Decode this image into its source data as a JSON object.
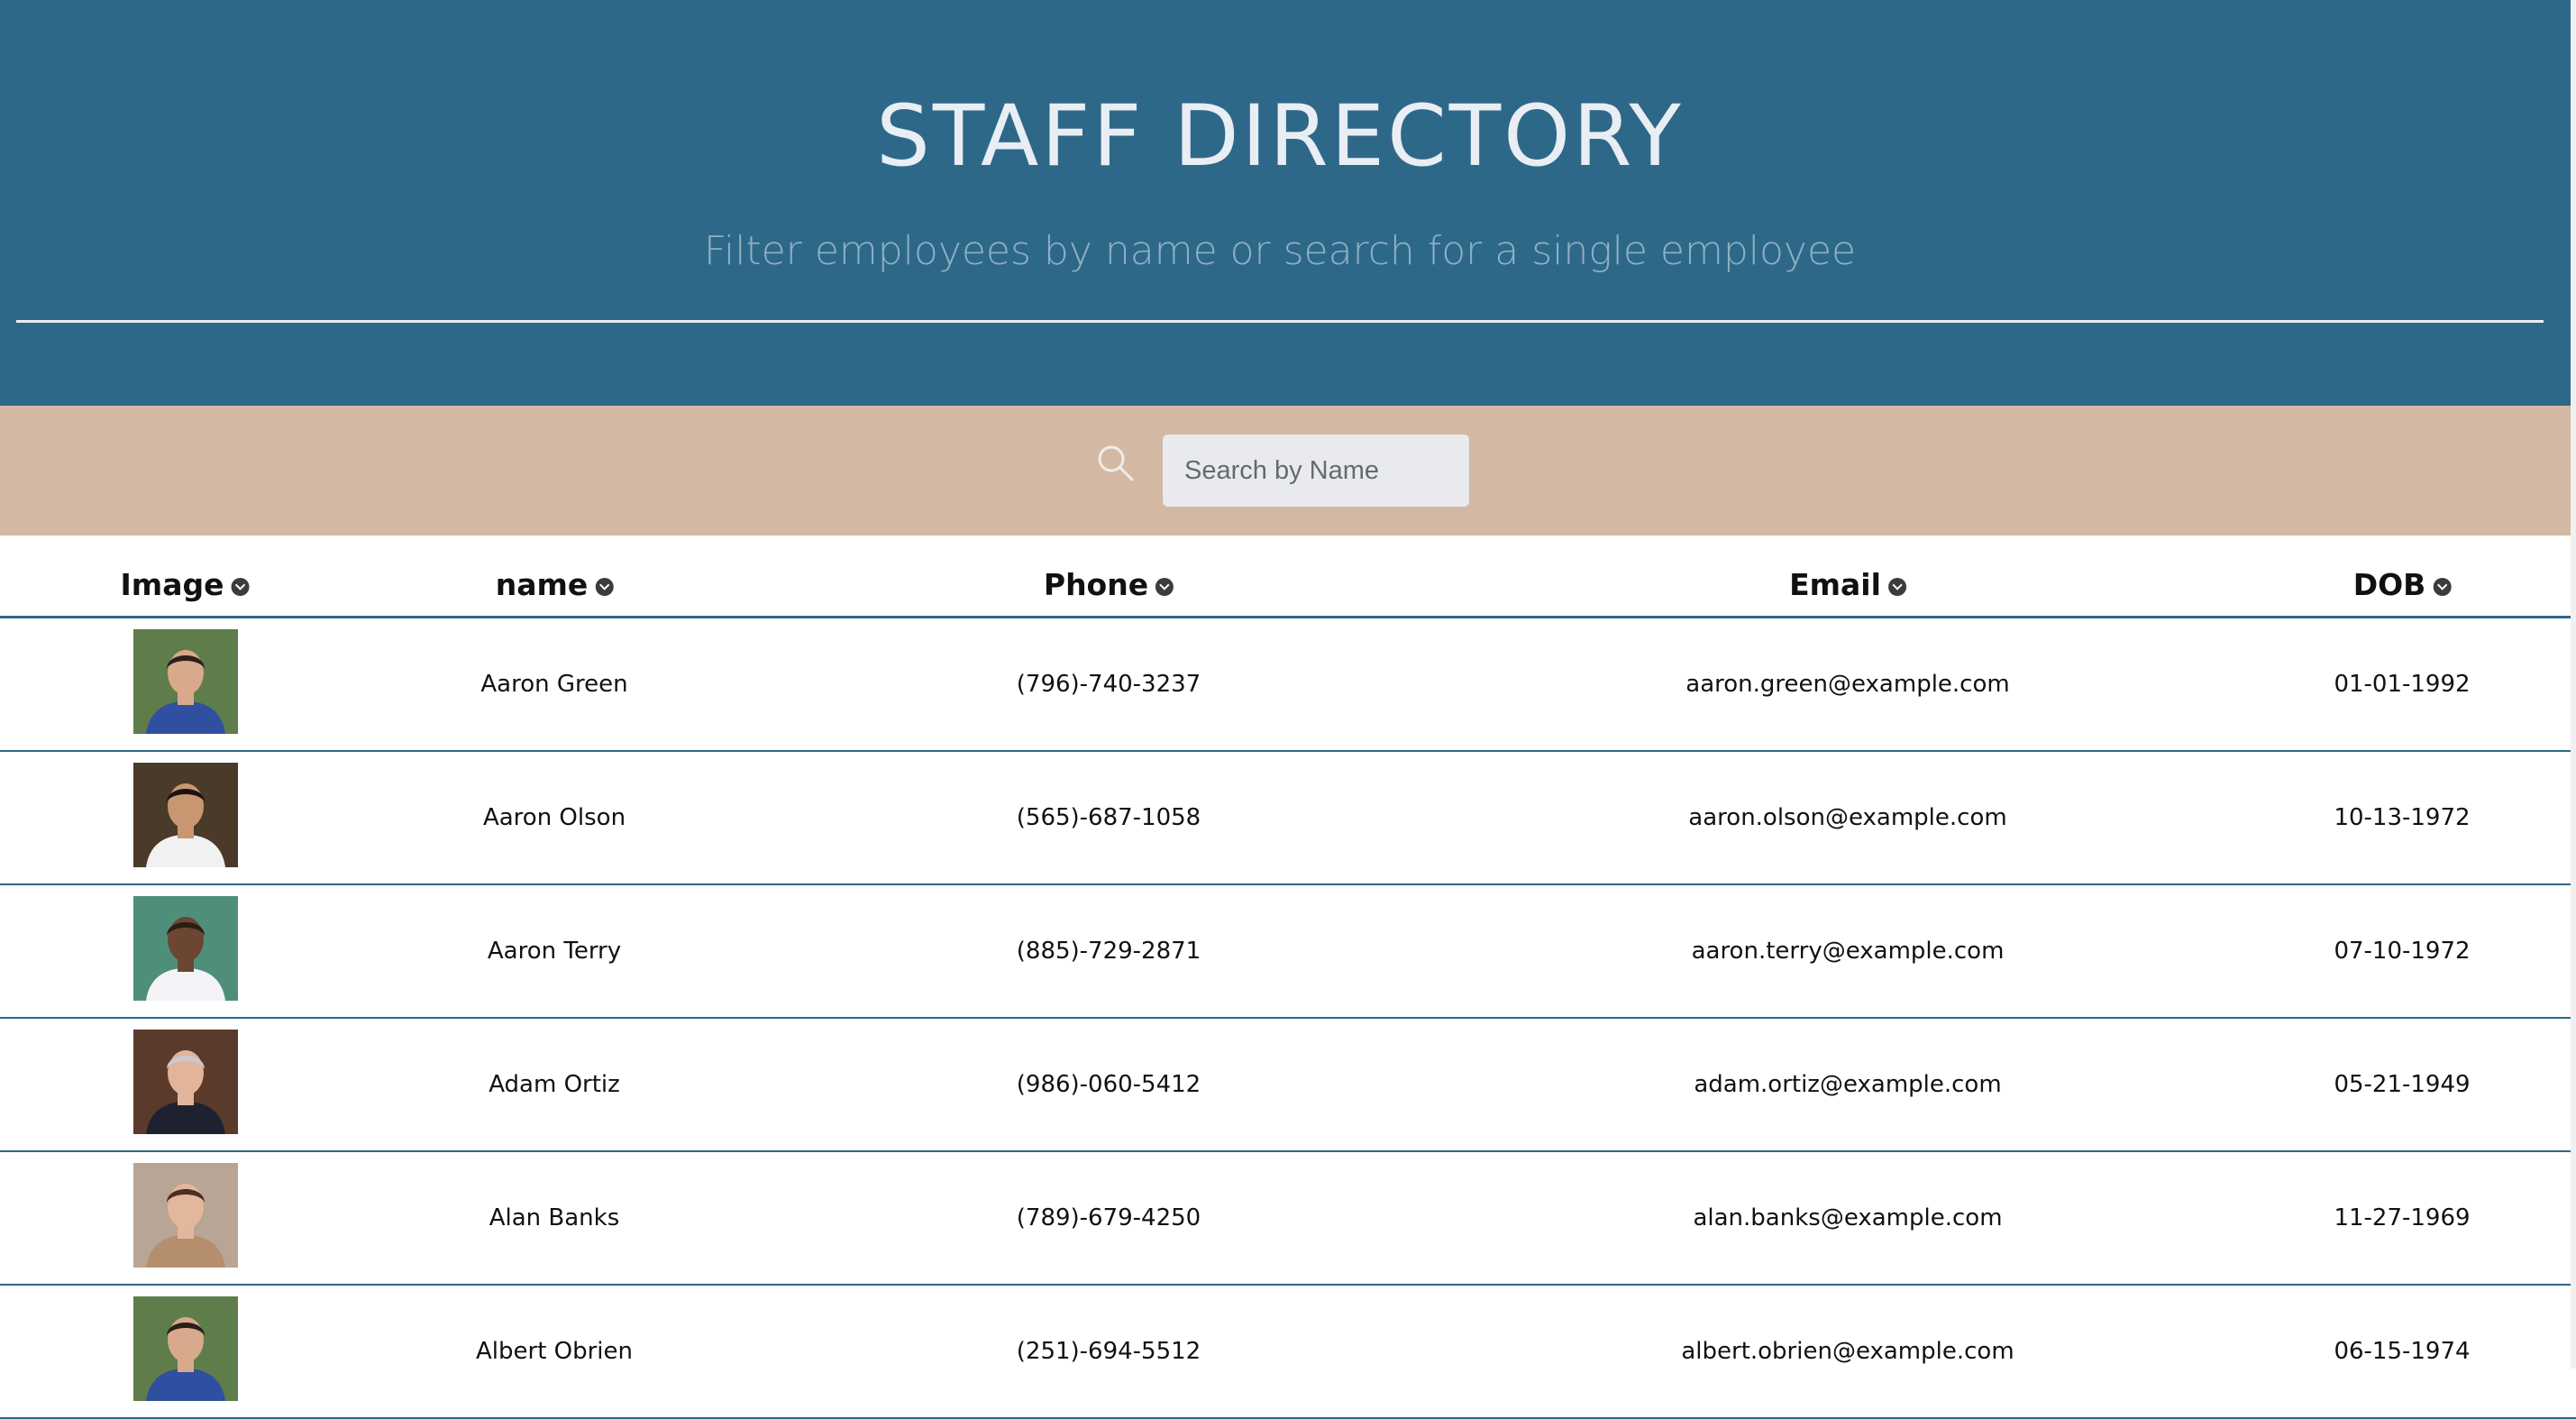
{
  "header": {
    "title": "STAFF DIRECTORY",
    "subtitle": "Filter employees by name or search for a single employee"
  },
  "search": {
    "icon": "search-icon",
    "placeholder": "Search by Name"
  },
  "table": {
    "columns": [
      {
        "key": "image",
        "label": "Image",
        "sort_icon": "sort-down-icon"
      },
      {
        "key": "name",
        "label": "name",
        "sort_icon": "sort-down-icon"
      },
      {
        "key": "phone",
        "label": "Phone",
        "sort_icon": "sort-down-icon"
      },
      {
        "key": "email",
        "label": "Email",
        "sort_icon": "sort-down-icon"
      },
      {
        "key": "dob",
        "label": "DOB",
        "sort_icon": "sort-down-icon"
      }
    ],
    "rows": [
      {
        "name": "Aaron Green",
        "phone": "(796)-740-3237",
        "email": "aaron.green@example.com",
        "dob": "01-01-1992",
        "photo": {
          "bg": "#5f7d4a",
          "skin": "#d9a98b",
          "hair": "#2a1f1a",
          "shirt": "#2f4fa0"
        }
      },
      {
        "name": "Aaron Olson",
        "phone": "(565)-687-1058",
        "email": "aaron.olson@example.com",
        "dob": "10-13-1972",
        "photo": {
          "bg": "#4a3a2a",
          "skin": "#c99672",
          "hair": "#1c1410",
          "shirt": "#f1f1f1"
        }
      },
      {
        "name": "Aaron Terry",
        "phone": "(885)-729-2871",
        "email": "aaron.terry@example.com",
        "dob": "07-10-1972",
        "photo": {
          "bg": "#4f8f7a",
          "skin": "#6b4630",
          "hair": "#2b1d14",
          "shirt": "#f4f4f8"
        }
      },
      {
        "name": "Adam Ortiz",
        "phone": "(986)-060-5412",
        "email": "adam.ortiz@example.com",
        "dob": "05-21-1949",
        "photo": {
          "bg": "#5a3a2a",
          "skin": "#e2b49a",
          "hair": "#c9c9c9",
          "shirt": "#1e2230"
        }
      },
      {
        "name": "Alan Banks",
        "phone": "(789)-679-4250",
        "email": "alan.banks@example.com",
        "dob": "11-27-1969",
        "photo": {
          "bg": "#b9a596",
          "skin": "#e3b79b",
          "hair": "#4a2f22",
          "shirt": "#b58f6d"
        }
      },
      {
        "name": "Albert Obrien",
        "phone": "(251)-694-5512",
        "email": "albert.obrien@example.com",
        "dob": "06-15-1974",
        "photo": {
          "bg": "#5f7d4a",
          "skin": "#d9a98b",
          "hair": "#2a1f1a",
          "shirt": "#2f4fa0"
        }
      }
    ]
  },
  "colors": {
    "header_bg": "#2e6889",
    "search_band_bg": "#d3b9a3",
    "row_divider": "#2e6889"
  }
}
